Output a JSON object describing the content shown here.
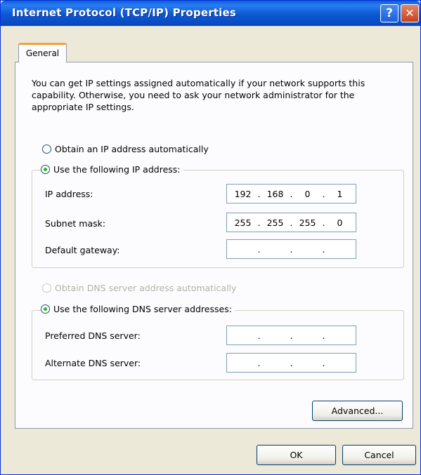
{
  "window": {
    "title": "Internet Protocol (TCP/IP) Properties",
    "help_glyph": "?",
    "close_glyph": "✕"
  },
  "tabs": [
    {
      "label": "General",
      "active": true
    }
  ],
  "description": "You can get IP settings assigned automatically if your network supports this capability. Otherwise, you need to ask your network administrator for the appropriate IP settings.",
  "ip_section": {
    "auto_label": "Obtain an IP address automatically",
    "manual_label": "Use the following IP address:",
    "selected": "manual",
    "fields": [
      {
        "label": "IP address:",
        "octets": [
          "192",
          "168",
          "0",
          "1"
        ]
      },
      {
        "label": "Subnet mask:",
        "octets": [
          "255",
          "255",
          "255",
          "0"
        ]
      },
      {
        "label": "Default gateway:",
        "octets": [
          "",
          "",
          "",
          ""
        ]
      }
    ]
  },
  "dns_section": {
    "auto_label": "Obtain DNS server address automatically",
    "auto_enabled": false,
    "manual_label": "Use the following DNS server addresses:",
    "selected": "manual",
    "fields": [
      {
        "label": "Preferred DNS server:",
        "octets": [
          "",
          "",
          "",
          ""
        ]
      },
      {
        "label": "Alternate DNS server:",
        "octets": [
          "",
          "",
          "",
          ""
        ]
      }
    ]
  },
  "buttons": {
    "advanced": "Advanced...",
    "ok": "OK",
    "cancel": "Cancel"
  },
  "colors": {
    "titlebar": "#0b58d2",
    "dialog_bg": "#ece9d8",
    "tab_accent": "#f2a23a",
    "radio_dot": "#2bb32b"
  }
}
